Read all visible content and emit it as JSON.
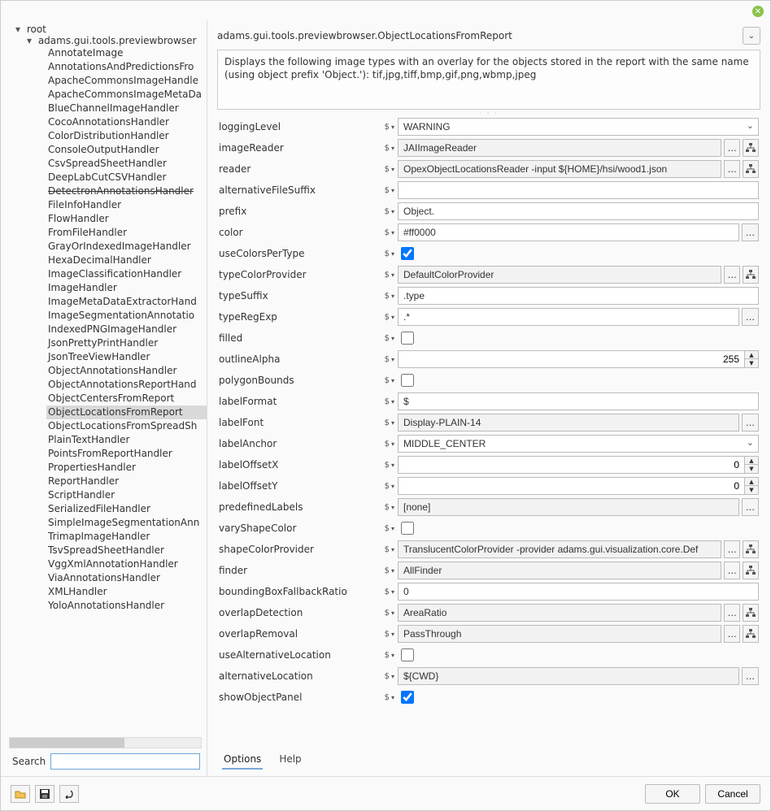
{
  "window": {
    "close_tooltip": "Close"
  },
  "tree": {
    "root_label": "root",
    "package_label": "adams.gui.tools.previewbrowser",
    "items": [
      {
        "label": "AnnotateImage"
      },
      {
        "label": "AnnotationsAndPredictionsFro"
      },
      {
        "label": "ApacheCommonsImageHandle"
      },
      {
        "label": "ApacheCommonsImageMetaDa"
      },
      {
        "label": "BlueChannelImageHandler"
      },
      {
        "label": "CocoAnnotationsHandler"
      },
      {
        "label": "ColorDistributionHandler"
      },
      {
        "label": "ConsoleOutputHandler"
      },
      {
        "label": "CsvSpreadSheetHandler"
      },
      {
        "label": "DeepLabCutCSVHandler"
      },
      {
        "label": "DetectronAnnotationsHandler",
        "strike": true
      },
      {
        "label": "FileInfoHandler"
      },
      {
        "label": "FlowHandler"
      },
      {
        "label": "FromFileHandler"
      },
      {
        "label": "GrayOrIndexedImageHandler"
      },
      {
        "label": "HexaDecimalHandler"
      },
      {
        "label": "ImageClassificationHandler"
      },
      {
        "label": "ImageHandler"
      },
      {
        "label": "ImageMetaDataExtractorHand"
      },
      {
        "label": "ImageSegmentationAnnotatio"
      },
      {
        "label": "IndexedPNGImageHandler"
      },
      {
        "label": "JsonPrettyPrintHandler"
      },
      {
        "label": "JsonTreeViewHandler"
      },
      {
        "label": "ObjectAnnotationsHandler"
      },
      {
        "label": "ObjectAnnotationsReportHand"
      },
      {
        "label": "ObjectCentersFromReport"
      },
      {
        "label": "ObjectLocationsFromReport",
        "selected": true
      },
      {
        "label": "ObjectLocationsFromSpreadSh"
      },
      {
        "label": "PlainTextHandler"
      },
      {
        "label": "PointsFromReportHandler"
      },
      {
        "label": "PropertiesHandler"
      },
      {
        "label": "ReportHandler"
      },
      {
        "label": "ScriptHandler"
      },
      {
        "label": "SerializedFileHandler"
      },
      {
        "label": "SimpleImageSegmentationAnn"
      },
      {
        "label": "TrimapImageHandler"
      },
      {
        "label": "TsvSpreadSheetHandler"
      },
      {
        "label": "VggXmlAnnotationHandler"
      },
      {
        "label": "ViaAnnotationsHandler"
      },
      {
        "label": "XMLHandler"
      },
      {
        "label": "YoloAnnotationsHandler"
      }
    ]
  },
  "search": {
    "label": "Search",
    "value": ""
  },
  "header": {
    "title": "adams.gui.tools.previewbrowser.ObjectLocationsFromReport",
    "description": "Displays the following image types with an overlay for the objects stored in the report with the same name (using object prefix 'Object.'): tif,jpg,tiff,bmp,gif,png,wbmp,jpeg"
  },
  "props": {
    "loggingLevel": {
      "label": "loggingLevel",
      "value": "WARNING"
    },
    "imageReader": {
      "label": "imageReader",
      "value": "JAIImageReader"
    },
    "reader": {
      "label": "reader",
      "value": "OpexObjectLocationsReader -input ${HOME}/hsi/wood1.json"
    },
    "alternativeFileSuffix": {
      "label": "alternativeFileSuffix",
      "value": ""
    },
    "prefix": {
      "label": "prefix",
      "value": "Object."
    },
    "color": {
      "label": "color",
      "value": "#ff0000"
    },
    "useColorsPerType": {
      "label": "useColorsPerType",
      "checked": true
    },
    "typeColorProvider": {
      "label": "typeColorProvider",
      "value": "DefaultColorProvider"
    },
    "typeSuffix": {
      "label": "typeSuffix",
      "value": ".type"
    },
    "typeRegExp": {
      "label": "typeRegExp",
      "value": ".*"
    },
    "filled": {
      "label": "filled",
      "checked": false
    },
    "outlineAlpha": {
      "label": "outlineAlpha",
      "value": "255"
    },
    "polygonBounds": {
      "label": "polygonBounds",
      "checked": false
    },
    "labelFormat": {
      "label": "labelFormat",
      "value": "$"
    },
    "labelFont": {
      "label": "labelFont",
      "value": "Display-PLAIN-14"
    },
    "labelAnchor": {
      "label": "labelAnchor",
      "value": "MIDDLE_CENTER"
    },
    "labelOffsetX": {
      "label": "labelOffsetX",
      "value": "0"
    },
    "labelOffsetY": {
      "label": "labelOffsetY",
      "value": "0"
    },
    "predefinedLabels": {
      "label": "predefinedLabels",
      "value": "[none]"
    },
    "varyShapeColor": {
      "label": "varyShapeColor",
      "checked": false
    },
    "shapeColorProvider": {
      "label": "shapeColorProvider",
      "value": "TranslucentColorProvider -provider adams.gui.visualization.core.Def"
    },
    "finder": {
      "label": "finder",
      "value": "AllFinder"
    },
    "boundingBoxFallbackRatio": {
      "label": "boundingBoxFallbackRatio",
      "value": "0"
    },
    "overlapDetection": {
      "label": "overlapDetection",
      "value": "AreaRatio"
    },
    "overlapRemoval": {
      "label": "overlapRemoval",
      "value": "PassThrough"
    },
    "useAlternativeLocation": {
      "label": "useAlternativeLocation",
      "checked": false
    },
    "alternativeLocation": {
      "label": "alternativeLocation",
      "value": "${CWD}"
    },
    "showObjectPanel": {
      "label": "showObjectPanel",
      "checked": true
    }
  },
  "tabs": {
    "options": "Options",
    "help": "Help"
  },
  "buttons": {
    "ok": "OK",
    "cancel": "Cancel"
  }
}
